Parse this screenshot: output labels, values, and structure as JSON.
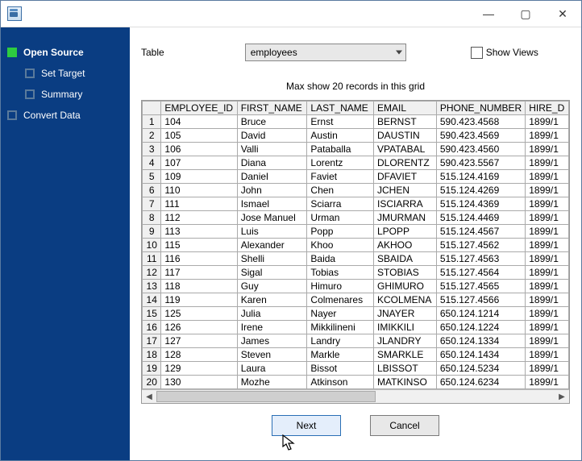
{
  "window": {
    "title": ""
  },
  "title_controls": {
    "min": "—",
    "max": "▢",
    "close": "✕"
  },
  "sidebar": {
    "steps": [
      {
        "label": "Open Source",
        "active": true
      },
      {
        "label": "Set Target",
        "active": false
      },
      {
        "label": "Summary",
        "active": false
      },
      {
        "label": "Convert Data",
        "active": false
      }
    ]
  },
  "table_selector": {
    "label": "Table",
    "value": "employees",
    "show_views_label": "Show Views",
    "show_views_checked": false
  },
  "hint": "Max show 20 records in this grid",
  "grid": {
    "columns": [
      "EMPLOYEE_ID",
      "FIRST_NAME",
      "LAST_NAME",
      "EMAIL",
      "PHONE_NUMBER",
      "HIRE_D"
    ],
    "rows": [
      [
        "104",
        "Bruce",
        "Ernst",
        "BERNST",
        "590.423.4568",
        "1899/1"
      ],
      [
        "105",
        "David",
        "Austin",
        "DAUSTIN",
        "590.423.4569",
        "1899/1"
      ],
      [
        "106",
        "Valli",
        "Pataballa",
        "VPATABAL",
        "590.423.4560",
        "1899/1"
      ],
      [
        "107",
        "Diana",
        "Lorentz",
        "DLORENTZ",
        "590.423.5567",
        "1899/1"
      ],
      [
        "109",
        "Daniel",
        "Faviet",
        "DFAVIET",
        "515.124.4169",
        "1899/1"
      ],
      [
        "110",
        "John",
        "Chen",
        "JCHEN",
        "515.124.4269",
        "1899/1"
      ],
      [
        "111",
        "Ismael",
        "Sciarra",
        "ISCIARRA",
        "515.124.4369",
        "1899/1"
      ],
      [
        "112",
        "Jose Manuel",
        "Urman",
        "JMURMAN",
        "515.124.4469",
        "1899/1"
      ],
      [
        "113",
        "Luis",
        "Popp",
        "LPOPP",
        "515.124.4567",
        "1899/1"
      ],
      [
        "115",
        "Alexander",
        "Khoo",
        "AKHOO",
        "515.127.4562",
        "1899/1"
      ],
      [
        "116",
        "Shelli",
        "Baida",
        "SBAIDA",
        "515.127.4563",
        "1899/1"
      ],
      [
        "117",
        "Sigal",
        "Tobias",
        "STOBIAS",
        "515.127.4564",
        "1899/1"
      ],
      [
        "118",
        "Guy",
        "Himuro",
        "GHIMURO",
        "515.127.4565",
        "1899/1"
      ],
      [
        "119",
        "Karen",
        "Colmenares",
        "KCOLMENA",
        "515.127.4566",
        "1899/1"
      ],
      [
        "125",
        "Julia",
        "Nayer",
        "JNAYER",
        "650.124.1214",
        "1899/1"
      ],
      [
        "126",
        "Irene",
        "Mikkilineni",
        "IMIKKILI",
        "650.124.1224",
        "1899/1"
      ],
      [
        "127",
        "James",
        "Landry",
        "JLANDRY",
        "650.124.1334",
        "1899/1"
      ],
      [
        "128",
        "Steven",
        "Markle",
        "SMARKLE",
        "650.124.1434",
        "1899/1"
      ],
      [
        "129",
        "Laura",
        "Bissot",
        "LBISSOT",
        "650.124.5234",
        "1899/1"
      ],
      [
        "130",
        "Mozhe",
        "Atkinson",
        "MATKINSO",
        "650.124.6234",
        "1899/1"
      ]
    ]
  },
  "buttons": {
    "next": "Next",
    "cancel": "Cancel"
  }
}
